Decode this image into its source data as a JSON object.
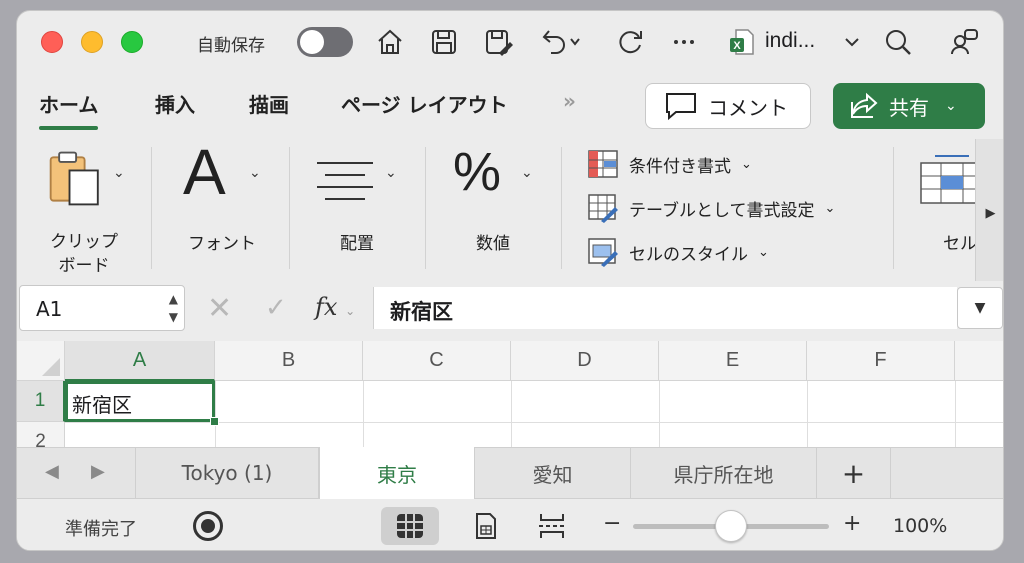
{
  "titlebar": {
    "autosave_label": "自動保存",
    "autosave_on": false,
    "file_name": "indi...",
    "icons": [
      "home-icon",
      "save-icon",
      "save-as-icon",
      "undo-icon",
      "redo-icon",
      "more-icon",
      "excel-file-icon",
      "search-icon",
      "share-people-icon"
    ]
  },
  "ribbon_tabs": {
    "items": [
      {
        "label": "ホーム",
        "active": true
      },
      {
        "label": "挿入"
      },
      {
        "label": "描画"
      },
      {
        "label": "ページ レイアウト"
      }
    ],
    "more": "»",
    "comment_label": "コメント",
    "share_label": "共有"
  },
  "ribbon": {
    "clipboard_label_1": "クリップ",
    "clipboard_label_2": "ボード",
    "font_label": "フォント",
    "font_glyph": "A",
    "align_label": "配置",
    "number_label": "数値",
    "number_glyph": "%",
    "conditional_format": "条件付き書式",
    "table_format": "テーブルとして書式設定",
    "cell_style": "セルのスタイル",
    "cells_label": "セル"
  },
  "formula_bar": {
    "name_box": "A1",
    "fx": "fx",
    "value": "新宿区"
  },
  "grid": {
    "columns": [
      "A",
      "B",
      "C",
      "D",
      "E",
      "F"
    ],
    "rows": [
      "1",
      "2"
    ],
    "selected_cell": "A1",
    "cell_a1": "新宿区"
  },
  "sheets": {
    "tabs": [
      {
        "label": "Tokyo (1)"
      },
      {
        "label": "東京",
        "active": true
      },
      {
        "label": "愛知"
      },
      {
        "label": "県庁所在地"
      }
    ],
    "add_label": "+"
  },
  "statusbar": {
    "status": "準備完了",
    "zoom": "100%",
    "zoom_level": 0.5,
    "minus": "−",
    "plus": "+"
  },
  "colors": {
    "accent": "#2f7d47",
    "close": "#ff5f57",
    "minimize": "#febc2e",
    "maximize": "#28c840"
  }
}
